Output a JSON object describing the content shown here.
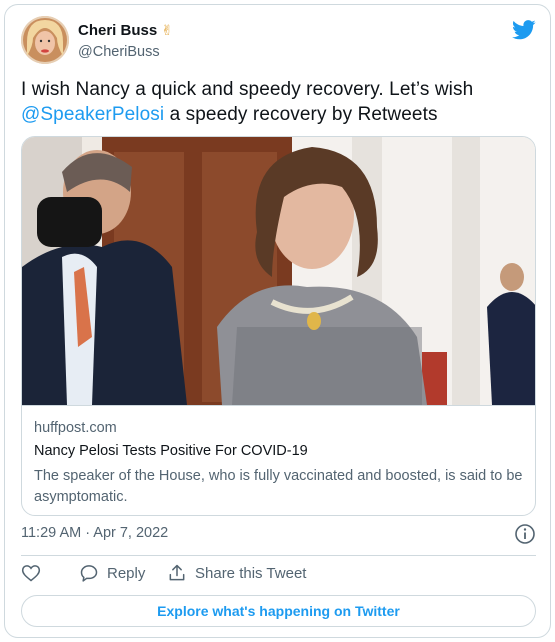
{
  "author": {
    "name": "Cheri Buss",
    "name_emoji": "✌",
    "handle": "@CheriBuss"
  },
  "tweet": {
    "text_before": "I wish Nancy a quick and speedy recovery. Let’s wish",
    "mention": "@SpeakerPelosi",
    "text_after": " a speedy recovery by Retweets"
  },
  "link_card": {
    "domain": "huffpost.com",
    "title": "Nancy Pelosi Tests Positive For COVID-19",
    "description": "The speaker of the House, who is fully vaccinated and boosted, is said to be asymptomatic."
  },
  "timestamp": "11:29 AM · Apr 7, 2022",
  "actions": {
    "like_icon": "heart-icon",
    "reply_label": "Reply",
    "share_label": "Share this Tweet"
  },
  "explore_label": "Explore what's happening on Twitter",
  "colors": {
    "accent": "#1d9bf0",
    "text": "#0f1419",
    "secondary": "#536471",
    "border": "#cfd9de"
  }
}
